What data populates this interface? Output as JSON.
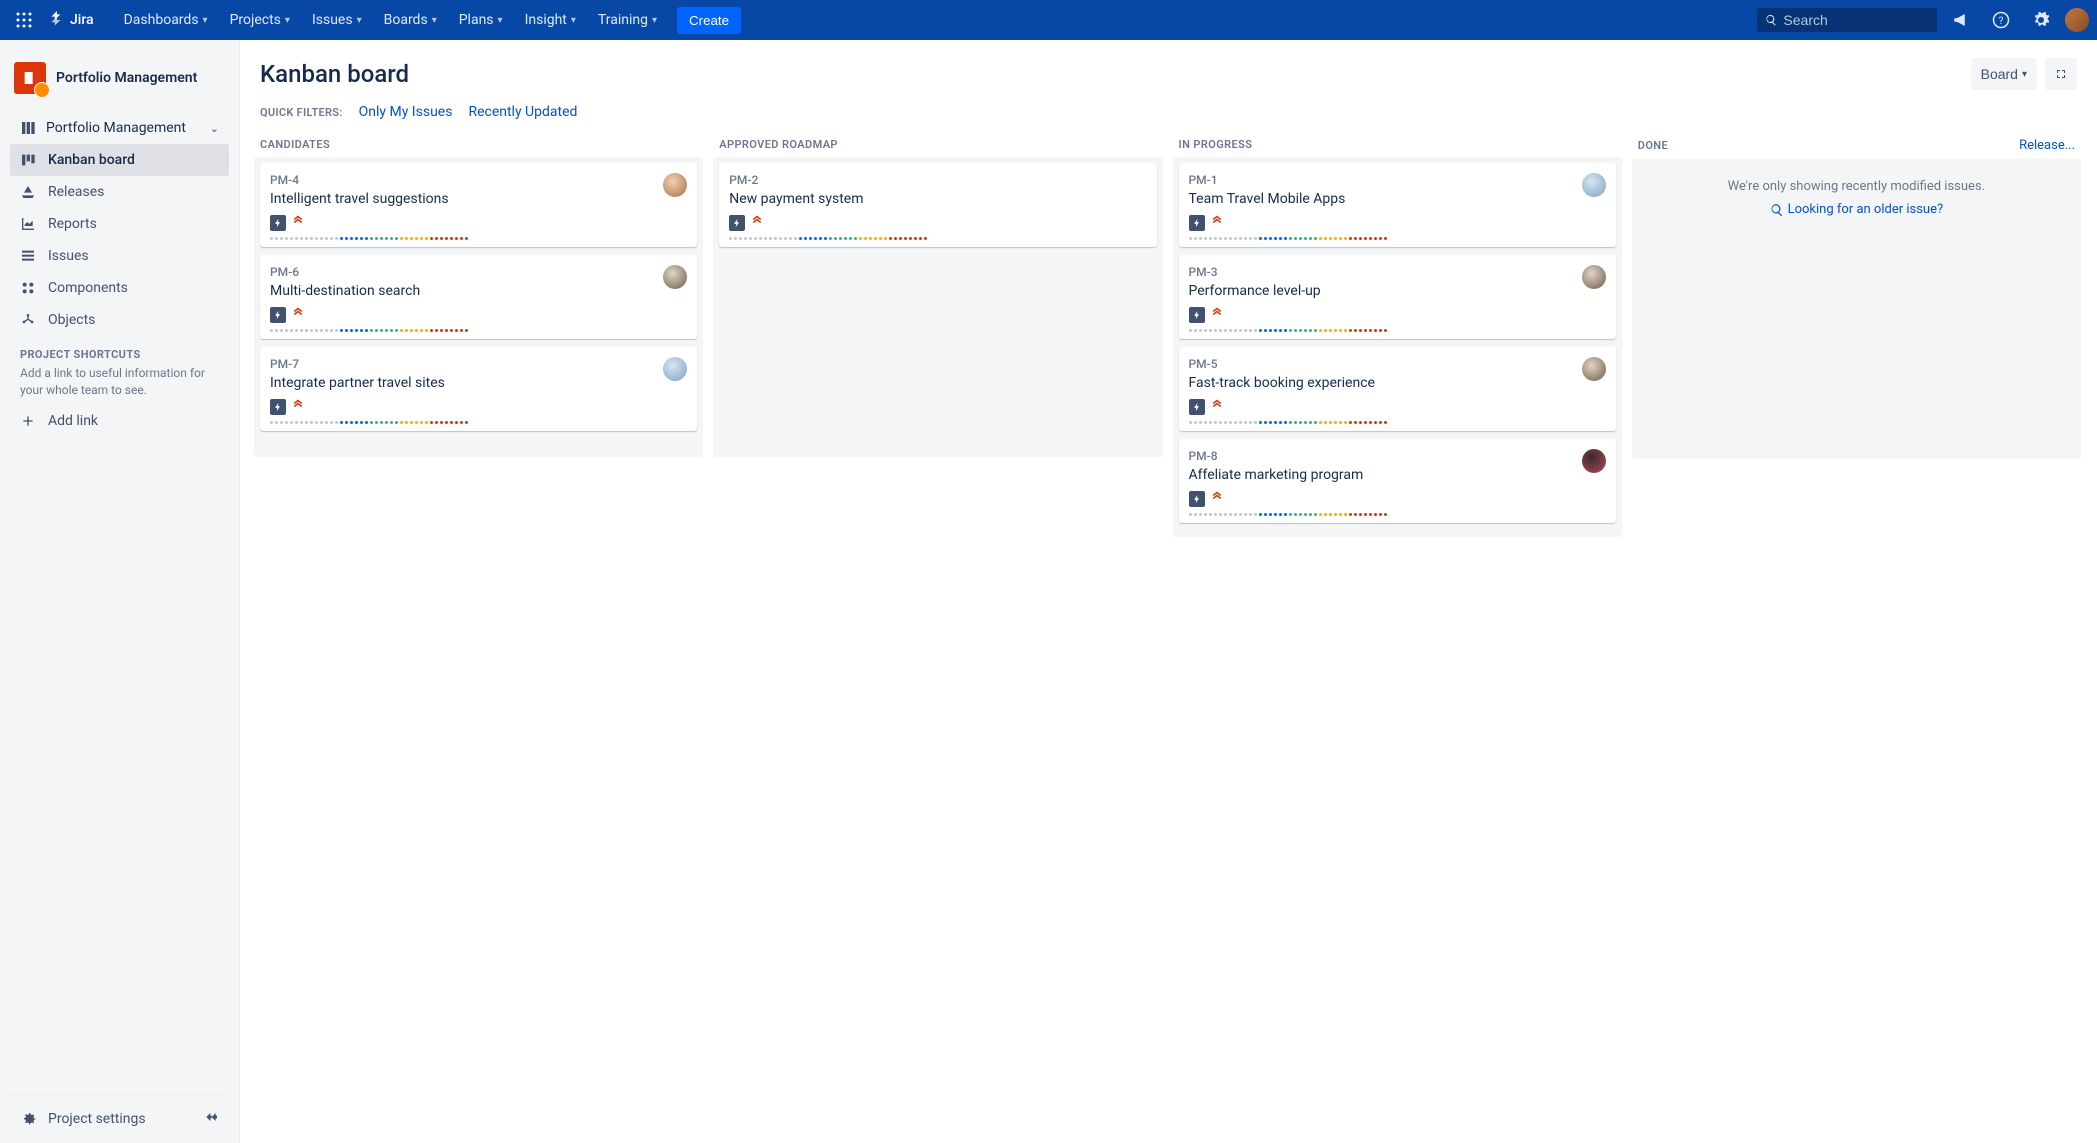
{
  "nav": {
    "product": "Jira",
    "links": [
      "Dashboards",
      "Projects",
      "Issues",
      "Boards",
      "Plans",
      "Insight",
      "Training"
    ],
    "create": "Create",
    "search_placeholder": "Search"
  },
  "sidebar": {
    "project_name": "Portfolio Management",
    "select_label": "Portfolio Management",
    "items": [
      {
        "label": "Kanban board",
        "active": true,
        "icon": "board"
      },
      {
        "label": "Releases",
        "icon": "ship"
      },
      {
        "label": "Reports",
        "icon": "chart"
      },
      {
        "label": "Issues",
        "icon": "list"
      },
      {
        "label": "Components",
        "icon": "component"
      },
      {
        "label": "Objects",
        "icon": "objects"
      }
    ],
    "shortcuts_label": "PROJECT SHORTCUTS",
    "shortcuts_desc": "Add a link to useful information for your whole team to see.",
    "add_link": "Add link",
    "settings": "Project settings"
  },
  "board": {
    "title": "Kanban board",
    "board_btn": "Board",
    "filters_label": "QUICK FILTERS:",
    "filters": [
      "Only My Issues",
      "Recently Updated"
    ],
    "release_link": "Release...",
    "done_msg": "We're only showing recently modified issues.",
    "done_link": "Looking for an older issue?",
    "columns": [
      {
        "id": "candidates",
        "title": "CANDIDATES",
        "cards": [
          {
            "key": "PM-4",
            "title": "Intelligent travel suggestions",
            "avatar": 0
          },
          {
            "key": "PM-6",
            "title": "Multi-destination search",
            "avatar": 2
          },
          {
            "key": "PM-7",
            "title": "Integrate partner travel sites",
            "avatar": 1
          }
        ]
      },
      {
        "id": "approved",
        "title": "APPROVED ROADMAP",
        "cards": [
          {
            "key": "PM-2",
            "title": "New payment system"
          }
        ]
      },
      {
        "id": "inprogress",
        "title": "IN PROGRESS",
        "cards": [
          {
            "key": "PM-1",
            "title": "Team Travel Mobile Apps",
            "avatar": 1
          },
          {
            "key": "PM-3",
            "title": "Performance level-up",
            "avatar": 2
          },
          {
            "key": "PM-5",
            "title": "Fast-track booking experience",
            "avatar": 2
          },
          {
            "key": "PM-8",
            "title": "Affeliate marketing program",
            "avatar": 3
          }
        ]
      },
      {
        "id": "done",
        "title": "DONE",
        "cards": []
      }
    ]
  }
}
